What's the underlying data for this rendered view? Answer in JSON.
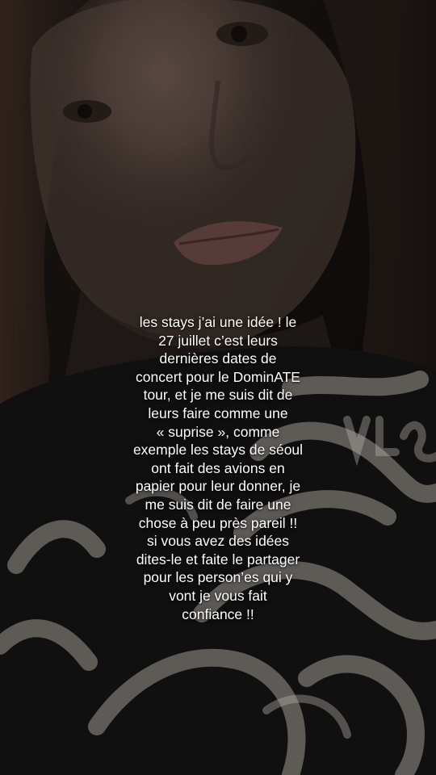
{
  "story": {
    "caption_lines": [
      "les stays j’ai une idée ! le",
      "27 juillet c’est leurs",
      "dernières dates de",
      "concert pour le DominATE",
      "tour, et je me suis dit de",
      "leurs faire comme une",
      "« suprise », comme",
      "exemple les stays de séoul",
      "ont fait des avions en",
      "papier pour leur donner, je",
      "me suis dit de faire une",
      "chose à peu près pareil !!",
      "si vous avez des idées",
      "dites-le et faite le partager",
      "pour les person’es qui y",
      "vont je vous fait",
      "confiance !!"
    ],
    "text_color": "#ffffff"
  }
}
